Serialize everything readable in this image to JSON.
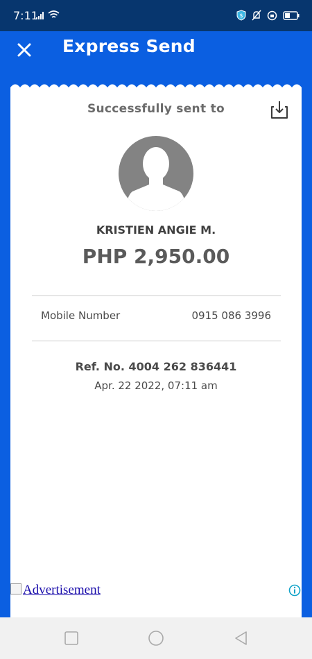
{
  "status_bar": {
    "time": "7:11",
    "icons": [
      "signal-icon",
      "wifi-icon",
      "vpn-shield-icon",
      "mute-bell-icon",
      "data-saver-icon",
      "battery-icon"
    ]
  },
  "app_bar": {
    "title": "Express Send",
    "close_icon": "close-icon"
  },
  "receipt": {
    "heading": "Successfully sent to",
    "download_icon": "download-icon",
    "recipient_name": "KRISTIEN ANGIE M.",
    "amount": "PHP 2,950.00",
    "details": [
      {
        "label": "Mobile Number",
        "value": "0915 086 3996"
      }
    ],
    "reference": "Ref. No. 4004 262 836441",
    "timestamp": "Apr. 22 2022, 07:11 am"
  },
  "ad": {
    "alt_text": "Advertisement",
    "info_icon": "info-icon"
  },
  "nav_bar": {
    "buttons": [
      "recents-square-icon",
      "home-circle-icon",
      "back-triangle-icon"
    ]
  },
  "colors": {
    "status_bar": "#07366e",
    "brand_blue": "#0b5fe1",
    "receipt_bg": "#ffffff",
    "avatar_gray": "#838383",
    "text_dark": "#4a4a4a"
  }
}
